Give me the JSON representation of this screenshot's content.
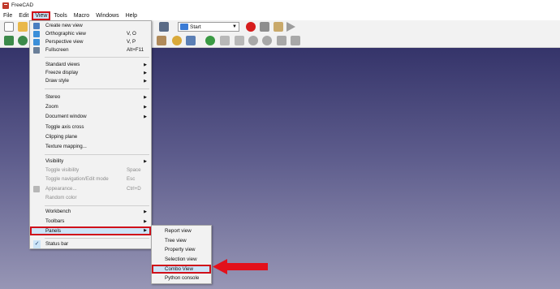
{
  "window": {
    "title": "FreeCAD"
  },
  "menubar": {
    "items": [
      "File",
      "Edit",
      "View",
      "Tools",
      "Macro",
      "Windows",
      "Help"
    ]
  },
  "workbench": {
    "selected": "Start"
  },
  "view_menu": {
    "create_new_view": "Create new view",
    "orthographic_view": "Orthographic view",
    "orthographic_shortcut": "V, O",
    "perspective_view": "Perspective view",
    "perspective_shortcut": "V, P",
    "fullscreen": "Fullscreen",
    "fullscreen_shortcut": "Alt+F11",
    "standard_views": "Standard views",
    "freeze_display": "Freeze display",
    "draw_style": "Draw style",
    "stereo": "Stereo",
    "zoom": "Zoom",
    "document_window": "Document window",
    "toggle_axis_cross": "Toggle axis cross",
    "clipping_plane": "Clipping plane",
    "texture_mapping": "Texture mapping...",
    "visibility": "Visibility",
    "toggle_visibility": "Toggle visibility",
    "toggle_visibility_shortcut": "Space",
    "toggle_navigation": "Toggle navigation/Edit mode",
    "toggle_navigation_shortcut": "Esc",
    "appearance": "Appearance...",
    "appearance_shortcut": "Ctrl+D",
    "random_color": "Random color",
    "workbench": "Workbench",
    "toolbars": "Toolbars",
    "panels": "Panels",
    "status_bar": "Status bar"
  },
  "panels_menu": {
    "report_view": "Report view",
    "tree_view": "Tree view",
    "property_view": "Property view",
    "selection_view": "Selection view",
    "combo_view": "Combo View",
    "python_console": "Python console"
  },
  "colors": {
    "highlight_outline": "#d0101a",
    "menu_highlight": "#cce4f7",
    "viewport_top": "#35346a",
    "viewport_bottom": "#9796b5"
  }
}
